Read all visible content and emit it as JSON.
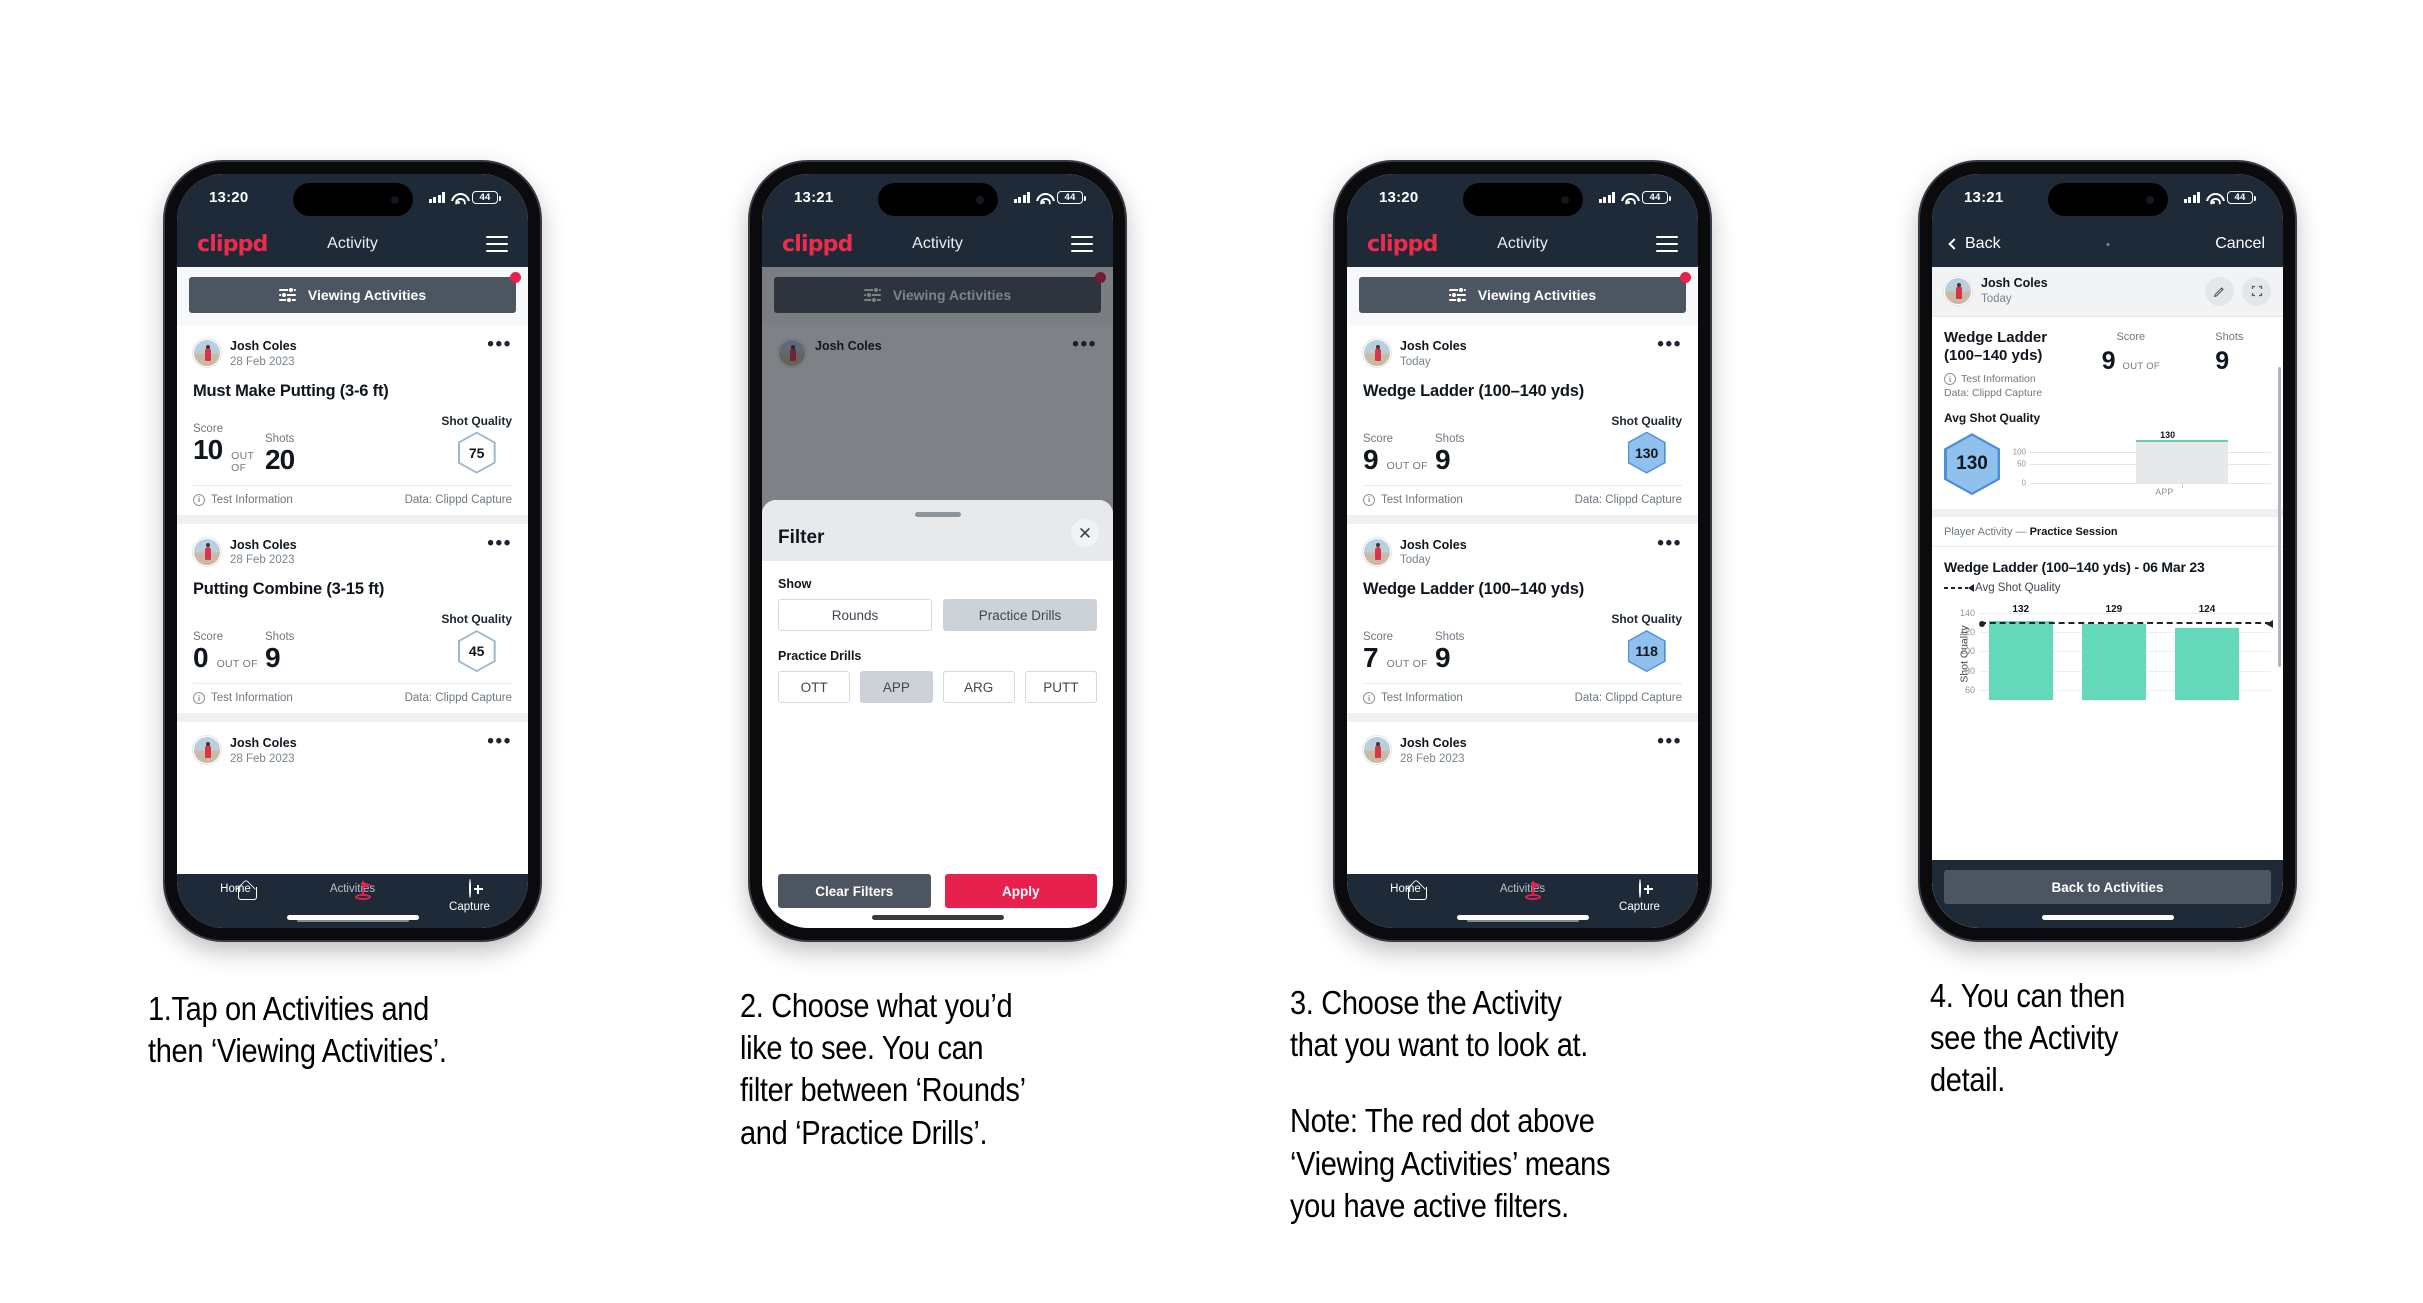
{
  "meta": {
    "brand": "clippd",
    "accent_red": "#e8204e",
    "dark_header": "#1e2a38",
    "bar_green": "#63d9b9",
    "hex_blue": "#8fc0ee"
  },
  "phone1": {
    "status": {
      "time": "13:20",
      "battery": "44"
    },
    "header": {
      "brand": "clippd",
      "title": "Activity",
      "menu_icon": "hamburger-icon"
    },
    "filter_button": {
      "label": "Viewing Activities",
      "icon": "sliders-icon",
      "has_badge": true
    },
    "cards": [
      {
        "user": "Josh Coles",
        "date": "28 Feb 2023",
        "title": "Must Make Putting (3-6 ft)",
        "score_label": "Score",
        "shots_label": "Shots",
        "quality_label": "Shot Quality",
        "score": "10",
        "out_of": "OUT OF",
        "shots": "20",
        "quality": "75",
        "quality_style": "outline",
        "foot_left": "Test Information",
        "foot_right": "Data: Clippd Capture"
      },
      {
        "user": "Josh Coles",
        "date": "28 Feb 2023",
        "title": "Putting Combine (3-15 ft)",
        "score_label": "Score",
        "shots_label": "Shots",
        "quality_label": "Shot Quality",
        "score": "0",
        "out_of": "OUT OF",
        "shots": "9",
        "quality": "45",
        "quality_style": "outline",
        "foot_left": "Test Information",
        "foot_right": "Data: Clippd Capture"
      }
    ],
    "partial_card": {
      "user": "Josh Coles",
      "date": "28 Feb 2023"
    },
    "tabs": [
      {
        "label": "Home",
        "icon": "home-icon",
        "active": false
      },
      {
        "label": "Activities",
        "icon": "golf-flag-icon",
        "active": true
      },
      {
        "label": "Capture",
        "icon": "plus-circle-icon",
        "active": false
      }
    ]
  },
  "phone2": {
    "status": {
      "time": "13:21",
      "battery": "44"
    },
    "header": {
      "brand": "clippd",
      "title": "Activity",
      "menu_icon": "hamburger-icon"
    },
    "filter_button": {
      "label": "Viewing Activities",
      "icon": "sliders-icon",
      "has_badge": true
    },
    "behind_card_user": "Josh Coles",
    "sheet": {
      "title": "Filter",
      "close_icon": "close-icon",
      "show_label": "Show",
      "show_options": [
        {
          "label": "Rounds",
          "selected": false
        },
        {
          "label": "Practice Drills",
          "selected": true
        }
      ],
      "drills_label": "Practice Drills",
      "drill_options": [
        {
          "label": "OTT",
          "selected": false
        },
        {
          "label": "APP",
          "selected": true
        },
        {
          "label": "ARG",
          "selected": false
        },
        {
          "label": "PUTT",
          "selected": false
        }
      ],
      "clear_label": "Clear Filters",
      "apply_label": "Apply"
    }
  },
  "phone3": {
    "status": {
      "time": "13:20",
      "battery": "44"
    },
    "header": {
      "brand": "clippd",
      "title": "Activity",
      "menu_icon": "hamburger-icon"
    },
    "filter_button": {
      "label": "Viewing Activities",
      "icon": "sliders-icon",
      "has_badge": true
    },
    "cards": [
      {
        "user": "Josh Coles",
        "date": "Today",
        "title": "Wedge Ladder (100–140 yds)",
        "score_label": "Score",
        "shots_label": "Shots",
        "quality_label": "Shot Quality",
        "score": "9",
        "out_of": "OUT OF",
        "shots": "9",
        "quality": "130",
        "quality_style": "filled",
        "foot_left": "Test Information",
        "foot_right": "Data: Clippd Capture"
      },
      {
        "user": "Josh Coles",
        "date": "Today",
        "title": "Wedge Ladder (100–140 yds)",
        "score_label": "Score",
        "shots_label": "Shots",
        "quality_label": "Shot Quality",
        "score": "7",
        "out_of": "OUT OF",
        "shots": "9",
        "quality": "118",
        "quality_style": "filled",
        "foot_left": "Test Information",
        "foot_right": "Data: Clippd Capture"
      }
    ],
    "partial_card": {
      "user": "Josh Coles",
      "date": "28 Feb 2023"
    },
    "tabs": [
      {
        "label": "Home",
        "icon": "home-icon",
        "active": false
      },
      {
        "label": "Activities",
        "icon": "golf-flag-icon",
        "active": true
      },
      {
        "label": "Capture",
        "icon": "plus-circle-icon",
        "active": false
      }
    ]
  },
  "phone4": {
    "status": {
      "time": "13:21",
      "battery": "44"
    },
    "nav": {
      "back_label": "Back",
      "cancel_label": "Cancel",
      "back_icon": "chevron-left-icon"
    },
    "user_row": {
      "name": "Josh Coles",
      "date": "Today",
      "edit_icon": "pencil-icon",
      "expand_icon": "fullscreen-icon"
    },
    "summary": {
      "title": "Wedge Ladder\n(100–140 yds)",
      "title_line1": "Wedge Ladder",
      "title_line2": "(100–140 yds)",
      "info_text": "Test Information",
      "data_text": "Data: Clippd Capture",
      "score_label": "Score",
      "shots_label": "Shots",
      "score": "9",
      "out_of": "OUT OF",
      "shots": "9"
    },
    "avg_section": {
      "label": "Avg Shot Quality",
      "value": "130"
    },
    "breadcrumb": {
      "prefix": "Player Activity — ",
      "bold": "Practice Session"
    },
    "chart_title": "Wedge Ladder (100–140 yds) - 06 Mar 23",
    "legend_label": "Avg Shot Quality",
    "back_button": "Back to Activities"
  },
  "chart_data": [
    {
      "type": "bar",
      "title": "Avg Shot Quality",
      "categories": [
        "APP"
      ],
      "values": [
        130
      ],
      "data_labels": [
        "130"
      ],
      "ylabel": "",
      "xlabel": "",
      "yticks": [
        0,
        50,
        100
      ],
      "ylim": [
        0,
        140
      ],
      "grid": true,
      "legend": false
    },
    {
      "type": "bar",
      "title": "Wedge Ladder (100–140 yds) - 06 Mar 23",
      "categories": [
        "",
        "",
        ""
      ],
      "values": [
        132,
        129,
        124
      ],
      "data_labels": [
        "132",
        "129",
        "124"
      ],
      "ylabel": "Shot Quality",
      "xlabel": "",
      "yticks": [
        60,
        80,
        100,
        120,
        140
      ],
      "ylim": [
        50,
        145
      ],
      "grid": true,
      "legend": true,
      "legend_entries": [
        "Avg Shot Quality"
      ],
      "legend_position": "top-left",
      "annotations": [
        {
          "type": "hline",
          "label": "Avg Shot Quality",
          "value": 130,
          "style": "dashed"
        }
      ],
      "bar_color": "#63d9b9"
    }
  ],
  "captions": [
    {
      "lines": [
        "1.Tap on Activities and",
        "then ‘Viewing Activities’."
      ]
    },
    {
      "lines": [
        "2. Choose what you’d",
        "like to see. You can",
        "filter between ‘Rounds’",
        "and ‘Practice Drills’."
      ]
    },
    {
      "lines": [
        "3. Choose the Activity",
        "that you want to look at."
      ],
      "lines2": [
        "Note: The red dot above",
        "‘Viewing Activities’ means",
        "you have active filters."
      ]
    },
    {
      "lines": [
        "4. You can then",
        "see the Activity",
        "detail."
      ]
    }
  ]
}
